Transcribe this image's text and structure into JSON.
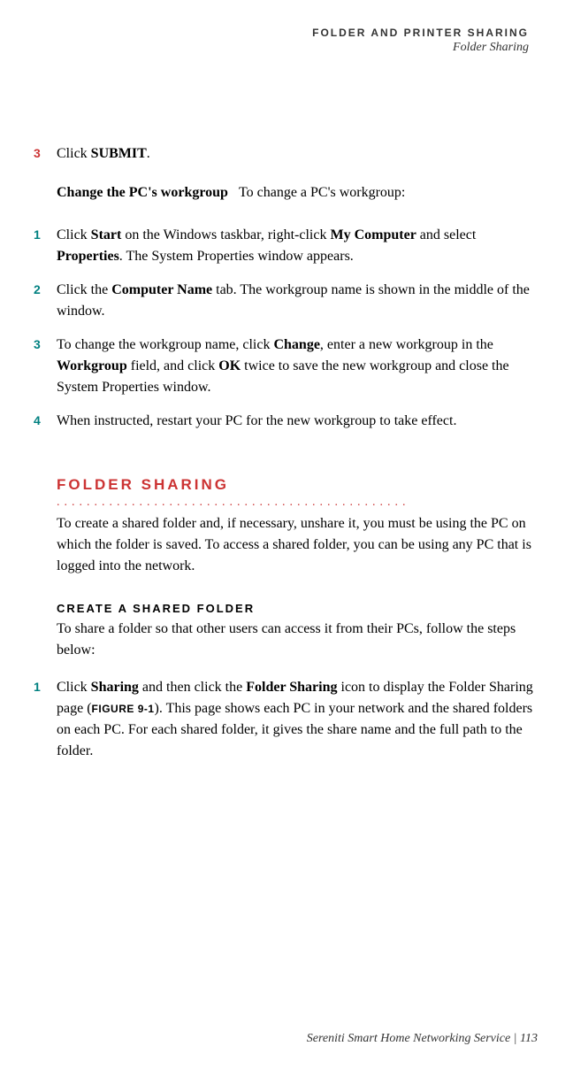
{
  "header": {
    "section": "FOLDER AND PRINTER SHARING",
    "subsection": "Folder Sharing"
  },
  "steps_a": [
    {
      "num": "3",
      "color": "red",
      "parts": [
        "Click ",
        "SUBMIT",
        "."
      ]
    }
  ],
  "change_workgroup": {
    "label": "Change the PC's workgroup",
    "text": "To change a PC's workgroup:"
  },
  "steps_b": {
    "s1": {
      "num": "1",
      "t1": "Click ",
      "b1": "Start",
      "t2": " on the Windows taskbar, right-click ",
      "b2": "My Computer",
      "t3": " and select ",
      "b3": "Properties",
      "t4": ". The System Properties window appears."
    },
    "s2": {
      "num": "2",
      "t1": "Click the ",
      "b1": "Computer Name",
      "t2": " tab. The workgroup name is shown in the middle of the window."
    },
    "s3": {
      "num": "3",
      "t1": "To change the workgroup name, click ",
      "b1": "Change",
      "t2": ", enter a new workgroup in the ",
      "b2": "Workgroup",
      "t3": " field, and click ",
      "b3": "OK",
      "t4": " twice to save the new workgroup and close the System Properties window."
    },
    "s4": {
      "num": "4",
      "t1": "When instructed, restart your PC for the new workgroup to take effect."
    }
  },
  "section": {
    "heading": "FOLDER SHARING",
    "intro": "To create a shared folder and, if necessary, unshare it, you must be using the PC on which the folder is saved. To access a shared folder, you can be using any PC that is logged into the network."
  },
  "subsection": {
    "heading": "CREATE A SHARED FOLDER",
    "intro": "To share a folder so that other users can access it from their PCs, follow the steps below:"
  },
  "steps_c": {
    "s1": {
      "num": "1",
      "t1": "Click ",
      "b1": "Sharing",
      "t2": " and then click the ",
      "b2": "Folder Sharing",
      "t3": " icon to display the Folder Sharing page (",
      "fig": "FIGURE 9-1",
      "t4": "). This page shows each PC in your network and the shared folders on each PC. For each shared folder, it gives the share name and the full path to the folder."
    }
  },
  "footer": "Sereniti Smart Home Networking Service | 113",
  "dots": "..............................................."
}
